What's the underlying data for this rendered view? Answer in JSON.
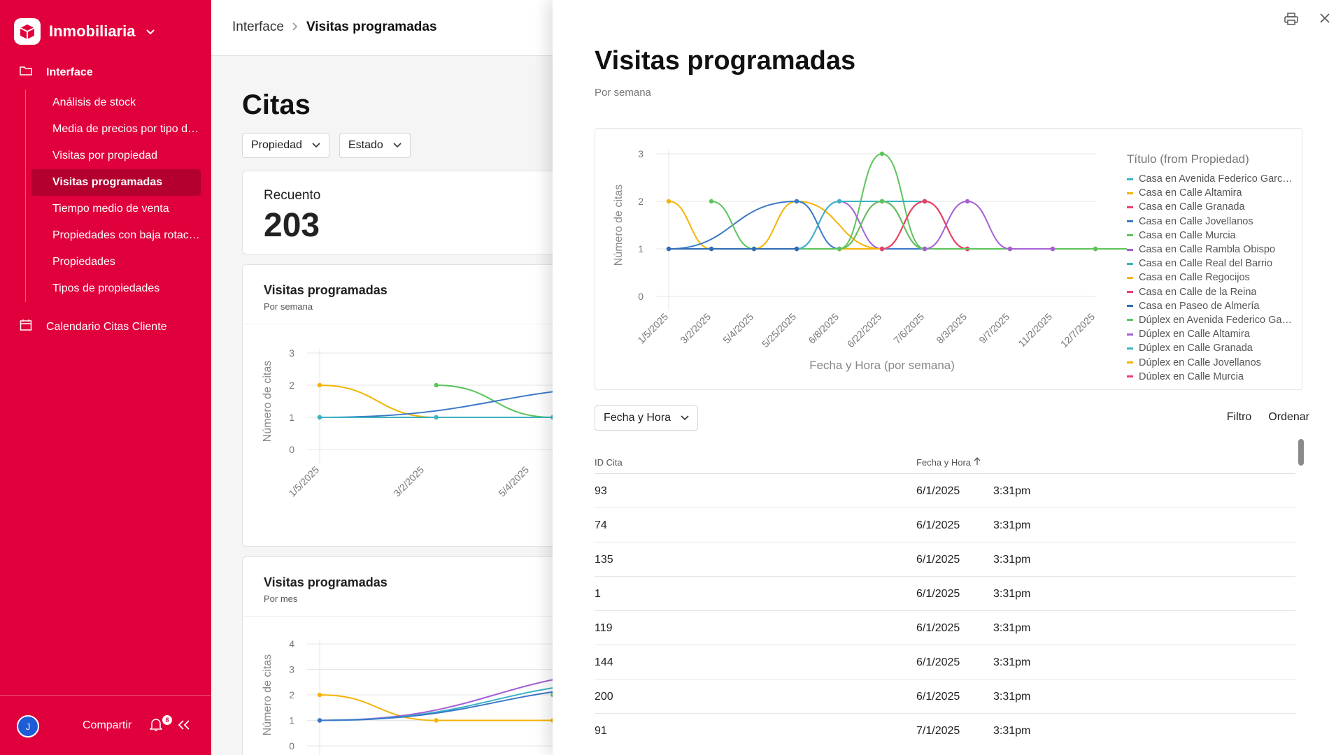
{
  "app": {
    "name": "Inmobiliaria"
  },
  "sidebar": {
    "group": "Interface",
    "items": [
      {
        "label": "Análisis de stock"
      },
      {
        "label": "Media de precios por tipo de propiedad"
      },
      {
        "label": "Visitas por propiedad"
      },
      {
        "label": "Visitas programadas",
        "active": true
      },
      {
        "label": "Tiempo medio de venta"
      },
      {
        "label": "Propiedades con baja rotación"
      },
      {
        "label": "Propiedades"
      },
      {
        "label": "Tipos de propiedades"
      }
    ],
    "calendar": "Calendario Citas Cliente",
    "footer": {
      "avatar": "J",
      "share": "Compartir",
      "badge": "8"
    }
  },
  "breadcrumb": {
    "root": "Interface",
    "current": "Visitas programadas"
  },
  "page": {
    "title": "Citas",
    "filters": [
      "Propiedad",
      "Estado"
    ],
    "count_label": "Recuento",
    "count_value": "203",
    "card1": {
      "title": "Visitas programadas",
      "subtitle": "Por semana"
    },
    "card2": {
      "title": "Visitas programadas",
      "subtitle": "Por mes"
    }
  },
  "panel": {
    "title": "Visitas programadas",
    "subtitle": "Por semana",
    "sort_field": "Fecha y Hora",
    "filter_label": "Filtro",
    "order_label": "Ordenar",
    "columns": [
      "ID Cita",
      "Fecha y Hora"
    ],
    "rows": [
      {
        "id": "93",
        "date": "6/1/2025",
        "time": "3:31pm"
      },
      {
        "id": "74",
        "date": "6/1/2025",
        "time": "3:31pm"
      },
      {
        "id": "135",
        "date": "6/1/2025",
        "time": "3:31pm"
      },
      {
        "id": "1",
        "date": "6/1/2025",
        "time": "3:31pm"
      },
      {
        "id": "119",
        "date": "6/1/2025",
        "time": "3:31pm"
      },
      {
        "id": "144",
        "date": "6/1/2025",
        "time": "3:31pm"
      },
      {
        "id": "200",
        "date": "6/1/2025",
        "time": "3:31pm"
      },
      {
        "id": "91",
        "date": "7/1/2025",
        "time": "3:31pm"
      }
    ]
  },
  "chart_data": [
    {
      "type": "line",
      "title": "",
      "xlabel": "Fecha y Hora (por semana)",
      "ylabel": "Número de citas",
      "ylim": [
        0,
        3
      ],
      "yticks": [
        0,
        1,
        2,
        3
      ],
      "categories": [
        "1/5/2025",
        "3/2/2025",
        "5/4/2025",
        "5/25/2025",
        "6/8/2025",
        "6/22/2025",
        "7/6/2025",
        "8/3/2025",
        "9/7/2025",
        "11/2/2025",
        "12/7/2025"
      ],
      "legend_title": "Título (from Propiedad)",
      "legend_position": "right",
      "series": [
        {
          "name": "Casa en Avenida Federico García Lorca",
          "color": "#3bb3c3",
          "x": [
            1,
            2,
            3,
            4,
            5,
            6,
            7,
            8,
            9,
            10,
            11
          ],
          "y": [
            1,
            1,
            1,
            1,
            1,
            1,
            1,
            1,
            1,
            1,
            1
          ]
        },
        {
          "name": "Casa en Calle Altamira",
          "color": "#f4b400",
          "x": [
            0,
            1,
            2,
            3,
            5,
            6,
            7
          ],
          "y": [
            2,
            1,
            1,
            2,
            1,
            2,
            1
          ]
        },
        {
          "name": "Casa en Calle Granada",
          "color": "#e83e6c",
          "x": [
            4,
            5,
            6,
            7
          ],
          "y": [
            1,
            2,
            1,
            1
          ]
        },
        {
          "name": "Casa en Calle Jovellanos",
          "color": "#3a78c9",
          "x": [
            0,
            3,
            4,
            5,
            6
          ],
          "y": [
            1,
            2,
            1,
            1,
            1
          ]
        },
        {
          "name": "Casa en Calle Murcia",
          "color": "#5cc45c",
          "x": [
            1,
            2,
            3,
            4,
            5,
            6,
            11
          ],
          "y": [
            2,
            1,
            1,
            1,
            3,
            1,
            1
          ]
        },
        {
          "name": "Casa en Calle Rambla Obispo",
          "color": "#a55fd6",
          "x": [
            3,
            4,
            5,
            6,
            7
          ],
          "y": [
            1,
            2,
            1,
            2,
            1
          ]
        },
        {
          "name": "Casa en Calle Real del Barrio",
          "color": "#3bb3c3",
          "x": [
            3,
            4,
            5,
            6
          ],
          "y": [
            1,
            2,
            2,
            2
          ]
        },
        {
          "name": "Casa en Calle Regocijos",
          "color": "#f4b400",
          "x": [
            4,
            5,
            6,
            7,
            8
          ],
          "y": [
            1,
            1,
            2,
            1,
            1
          ]
        },
        {
          "name": "Casa en Calle de la Reina",
          "color": "#e83e6c",
          "x": [
            5,
            6,
            7,
            8,
            9,
            10
          ],
          "y": [
            1,
            2,
            1,
            1,
            1,
            1
          ]
        },
        {
          "name": "Casa en Paseo de Almería",
          "color": "#2f6db5",
          "x": [
            0,
            1,
            2,
            3
          ],
          "y": [
            1,
            1,
            1,
            1
          ]
        },
        {
          "name": "Dúplex en Avenida Federico García Lorca",
          "color": "#5cc45c",
          "x": [
            4,
            5,
            6,
            10,
            11
          ],
          "y": [
            1,
            2,
            1,
            1,
            1
          ]
        },
        {
          "name": "Dúplex en Calle Altamira",
          "color": "#a55fd6",
          "x": [
            6,
            7,
            8,
            9
          ],
          "y": [
            1,
            2,
            1,
            1
          ]
        },
        {
          "name": "Dúplex en Calle Granada",
          "color": "#3bb3c3",
          "x": [],
          "y": []
        },
        {
          "name": "Dúplex en Calle Jovellanos",
          "color": "#f4b400",
          "x": [],
          "y": []
        },
        {
          "name": "Dúplex en Calle Murcia",
          "color": "#e83e6c",
          "x": [],
          "y": []
        }
      ]
    },
    {
      "type": "line",
      "title": "Visitas programadas",
      "subtitle": "Por semana",
      "xlabel": "",
      "ylabel": "Número de citas",
      "ylim": [
        0,
        3
      ],
      "yticks": [
        0,
        1,
        2,
        3
      ],
      "categories": [
        "1/5/2025",
        "3/2/2025",
        "5/4/2025",
        "5/25/2025"
      ],
      "series": [
        {
          "color": "#f4b400",
          "x": [
            0,
            1,
            2,
            3
          ],
          "y": [
            2,
            1,
            1,
            2
          ]
        },
        {
          "color": "#5cc45c",
          "x": [
            1,
            2,
            3
          ],
          "y": [
            2,
            1,
            1
          ]
        },
        {
          "color": "#3a78c9",
          "x": [
            0,
            3
          ],
          "y": [
            1,
            2
          ]
        },
        {
          "color": "#3bb3c3",
          "x": [
            0,
            1,
            2,
            3
          ],
          "y": [
            1,
            1,
            1,
            1
          ]
        },
        {
          "color": "#a55fd6",
          "x": [
            3,
            3.5
          ],
          "y": [
            1,
            2
          ]
        }
      ]
    },
    {
      "type": "line",
      "title": "Visitas programadas",
      "subtitle": "Por mes",
      "xlabel": "",
      "ylabel": "Número de citas",
      "ylim": [
        0,
        4
      ],
      "yticks": [
        0,
        1,
        2,
        3,
        4
      ],
      "categories": [],
      "series": [
        {
          "color": "#f4b400",
          "x": [
            0,
            1,
            2,
            3
          ],
          "y": [
            2,
            1,
            1,
            1
          ]
        },
        {
          "color": "#a55fd6",
          "x": [
            0,
            3
          ],
          "y": [
            1,
            3
          ]
        },
        {
          "color": "#3bb3c3",
          "x": [
            0,
            3
          ],
          "y": [
            1,
            2.6
          ]
        },
        {
          "color": "#5cc45c",
          "x": [
            2,
            3
          ],
          "y": [
            2,
            2
          ]
        },
        {
          "color": "#3a78c9",
          "x": [
            0,
            3
          ],
          "y": [
            1,
            2.4
          ]
        }
      ]
    }
  ]
}
